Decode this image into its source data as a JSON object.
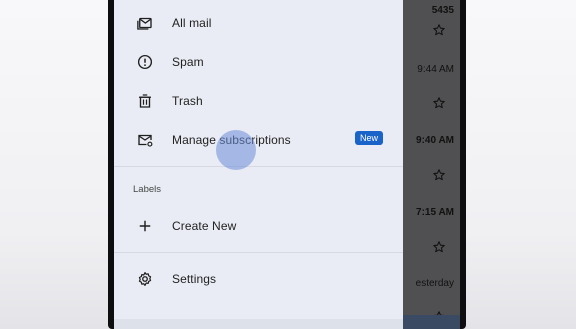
{
  "drawer": {
    "items": [
      {
        "label": "All mail",
        "icon": "all-mail-icon"
      },
      {
        "label": "Spam",
        "icon": "spam-icon"
      },
      {
        "label": "Trash",
        "icon": "trash-icon"
      },
      {
        "label": "Manage subscriptions",
        "icon": "manage-subscriptions-icon",
        "badge": "New"
      }
    ],
    "labels_header": "Labels",
    "create_new": {
      "label": "Create New",
      "icon": "plus-icon"
    },
    "settings": {
      "label": "Settings",
      "icon": "gear-icon"
    }
  },
  "inbox_peek": {
    "times": [
      "5435",
      "9:44 AM",
      "9:40 AM",
      "7:15 AM",
      "esterday"
    ]
  },
  "colors": {
    "drawer_bg": "#e9ecf4",
    "badge_bg": "#1a63c9",
    "accent_ripple": "#6e8cd7"
  }
}
